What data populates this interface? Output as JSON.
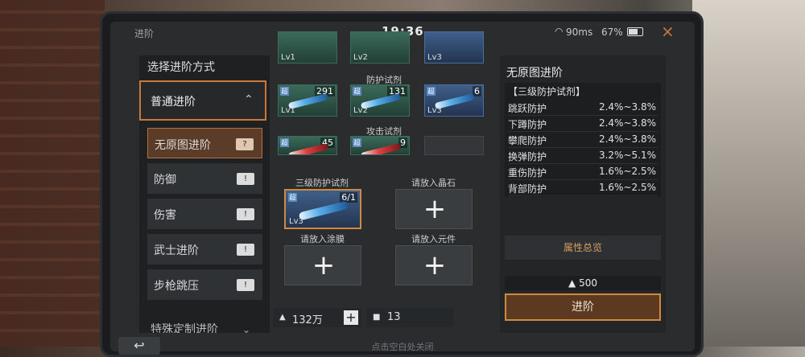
{
  "topbar": {
    "title": "进阶",
    "time": "19:36",
    "ping": "90ms",
    "battery": "67%",
    "close_icon": "×"
  },
  "left_panel": {
    "title": "选择进阶方式",
    "mode": "普通进阶",
    "items": [
      {
        "label": "无原图进阶",
        "active": true
      },
      {
        "label": "防御",
        "active": false
      },
      {
        "label": "伤害",
        "active": false
      },
      {
        "label": "武士进阶",
        "active": false
      },
      {
        "label": "步枪跳压",
        "active": false
      }
    ],
    "more": "特殊定制进阶"
  },
  "middle": {
    "top_row": [
      "Lv1",
      "Lv2",
      "Lv3"
    ],
    "defense_label": "防护试剂",
    "defense_slots": [
      {
        "count": "291",
        "lv": "Lv1"
      },
      {
        "count": "131",
        "lv": "Lv2"
      },
      {
        "count": "6",
        "lv": "Lv3"
      }
    ],
    "attack_label": "攻击试剂",
    "attack_slots": [
      {
        "count": "45"
      },
      {
        "count": "9"
      }
    ],
    "target_label": "三级防护试剂",
    "target_count": "6/1",
    "target_lv": "Lv3",
    "crystal_label": "请放入晶石",
    "coating_label": "请放入涂膜",
    "part_label": "请放入元件",
    "currency_amount": "132万",
    "ticket_amount": "13"
  },
  "right_panel": {
    "title": "无原图进阶",
    "attr_head": "【三级防护试剂】",
    "attributes": [
      {
        "name": "跳跃防护",
        "value": "2.4%~3.8%"
      },
      {
        "name": "下蹲防护",
        "value": "2.4%~3.8%"
      },
      {
        "name": "攀爬防护",
        "value": "2.4%~3.8%"
      },
      {
        "name": "换弹防护",
        "value": "3.2%~5.1%"
      },
      {
        "name": "重伤防护",
        "value": "1.6%~2.5%"
      },
      {
        "name": "背部防护",
        "value": "1.6%~2.5%"
      }
    ],
    "summary": "属性总览",
    "cost": "500",
    "go": "进阶"
  },
  "bottom": {
    "hint": "点击空白处关闭"
  },
  "colors": {
    "accent": "#d08a40",
    "panel": "#232527"
  }
}
